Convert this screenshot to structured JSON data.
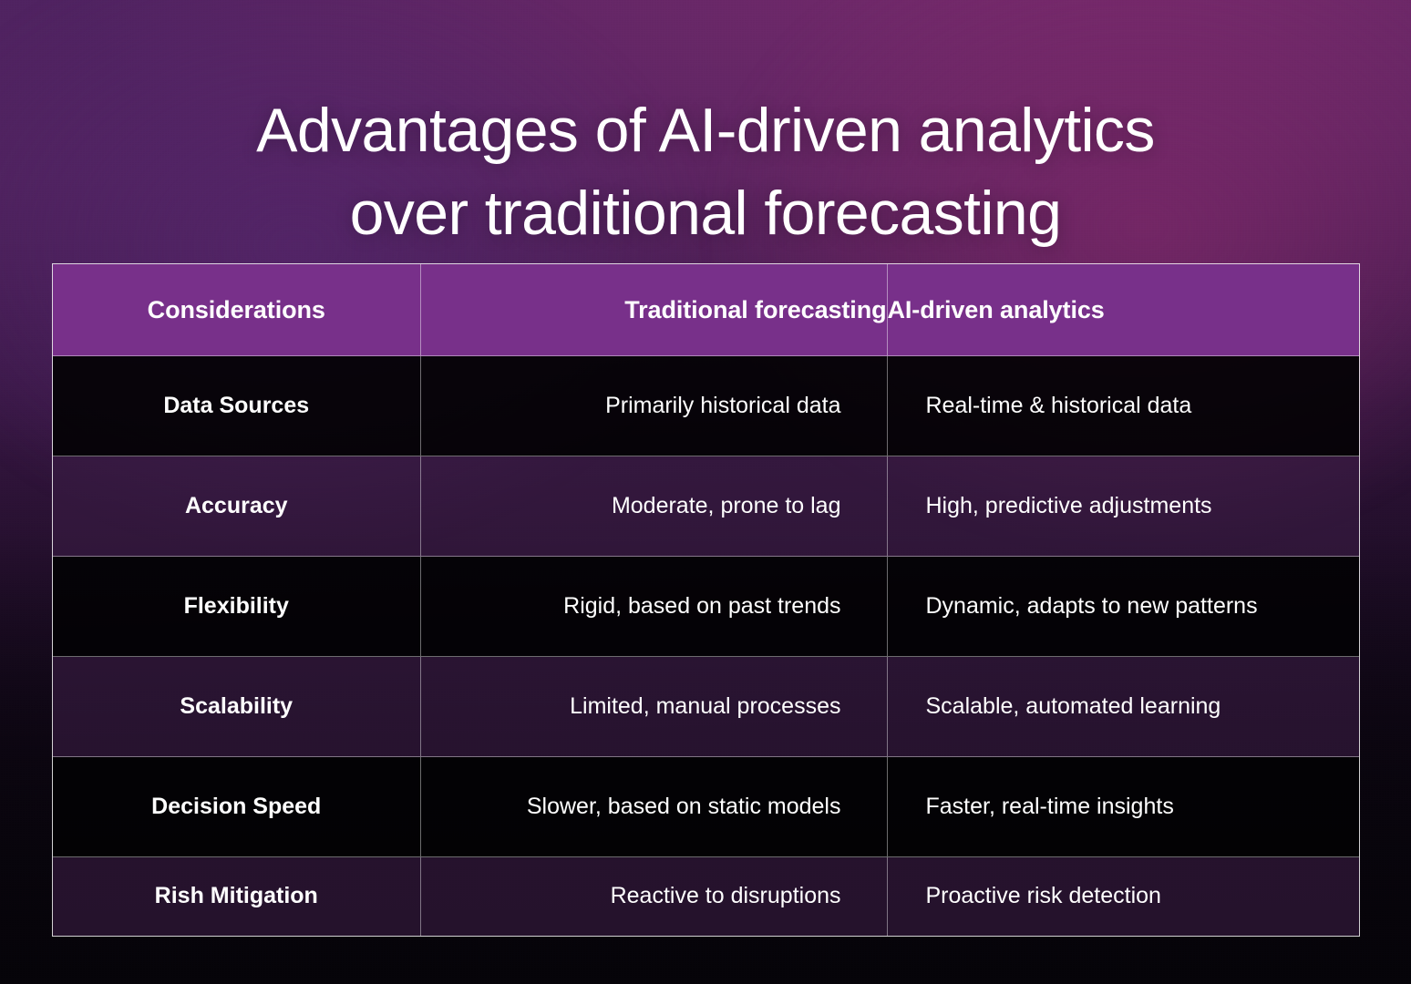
{
  "slide": {
    "title": "Advantages of AI-driven analytics\nover traditional forecasting",
    "background": {
      "top_left_color": "#4e2260",
      "top_right_color": "#7a2a6d",
      "bottom_color": "#070409"
    }
  },
  "table": {
    "header_color": "#78308a",
    "border_color": "#ffffff",
    "headers": [
      "Considerations",
      "Traditional forecasting",
      "AI-driven analytics"
    ],
    "rows": [
      {
        "consideration": "Data Sources",
        "traditional": "Primarily historical data",
        "ai_driven": "Real-time & historical data"
      },
      {
        "consideration": "Accuracy",
        "traditional": "Moderate, prone to lag",
        "ai_driven": "High, predictive adjustments"
      },
      {
        "consideration": "Flexibility",
        "traditional": "Rigid, based on past trends",
        "ai_driven": "Dynamic, adapts to new patterns"
      },
      {
        "consideration": "Scalability",
        "traditional": "Limited, manual processes",
        "ai_driven": "Scalable, automated learning"
      },
      {
        "consideration": "Decision Speed",
        "traditional": "Slower, based on static models",
        "ai_driven": "Faster, real-time insights"
      },
      {
        "consideration": "Rish Mitigation",
        "traditional": "Reactive to disruptions",
        "ai_driven": "Proactive risk detection"
      }
    ]
  }
}
